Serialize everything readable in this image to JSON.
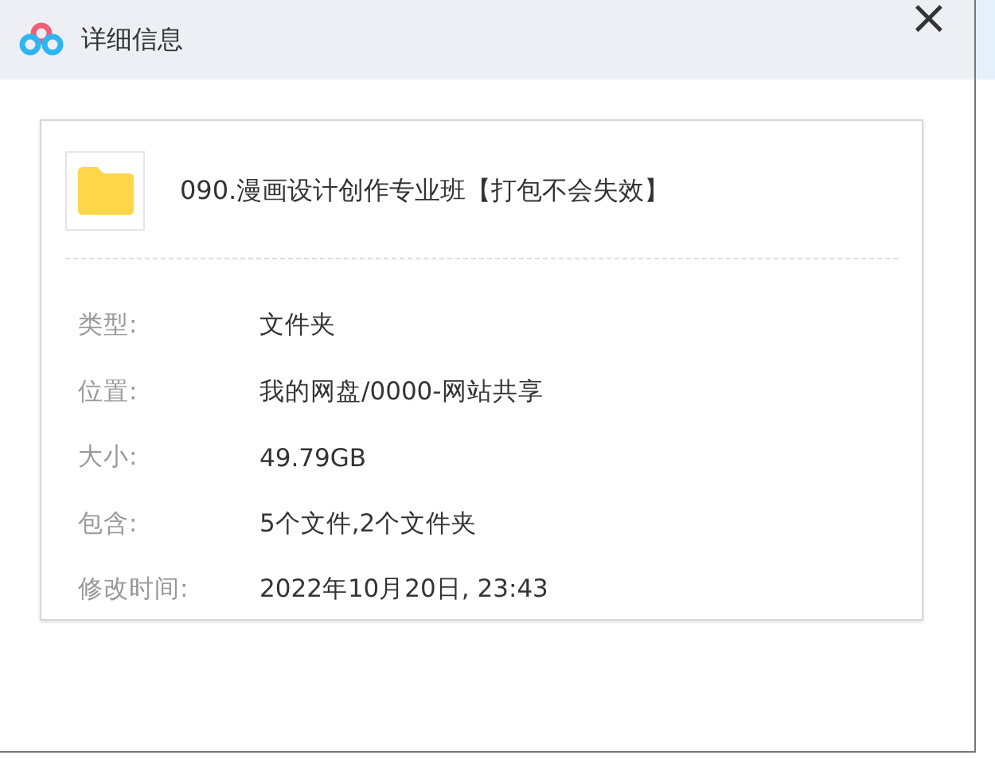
{
  "window": {
    "title": "详细信息",
    "close": "×"
  },
  "file": {
    "name": "090.漫画设计创作专业班【打包不会失效】"
  },
  "details": [
    {
      "label": "类型:",
      "value": "文件夹"
    },
    {
      "label": "位置:",
      "value": "我的网盘/0000-网站共享"
    },
    {
      "label": "大小:",
      "value": "49.79GB"
    },
    {
      "label": "包含:",
      "value": "5个文件,2个文件夹"
    },
    {
      "label": "修改时间:",
      "value": "2022年10月20日, 23:43"
    }
  ]
}
